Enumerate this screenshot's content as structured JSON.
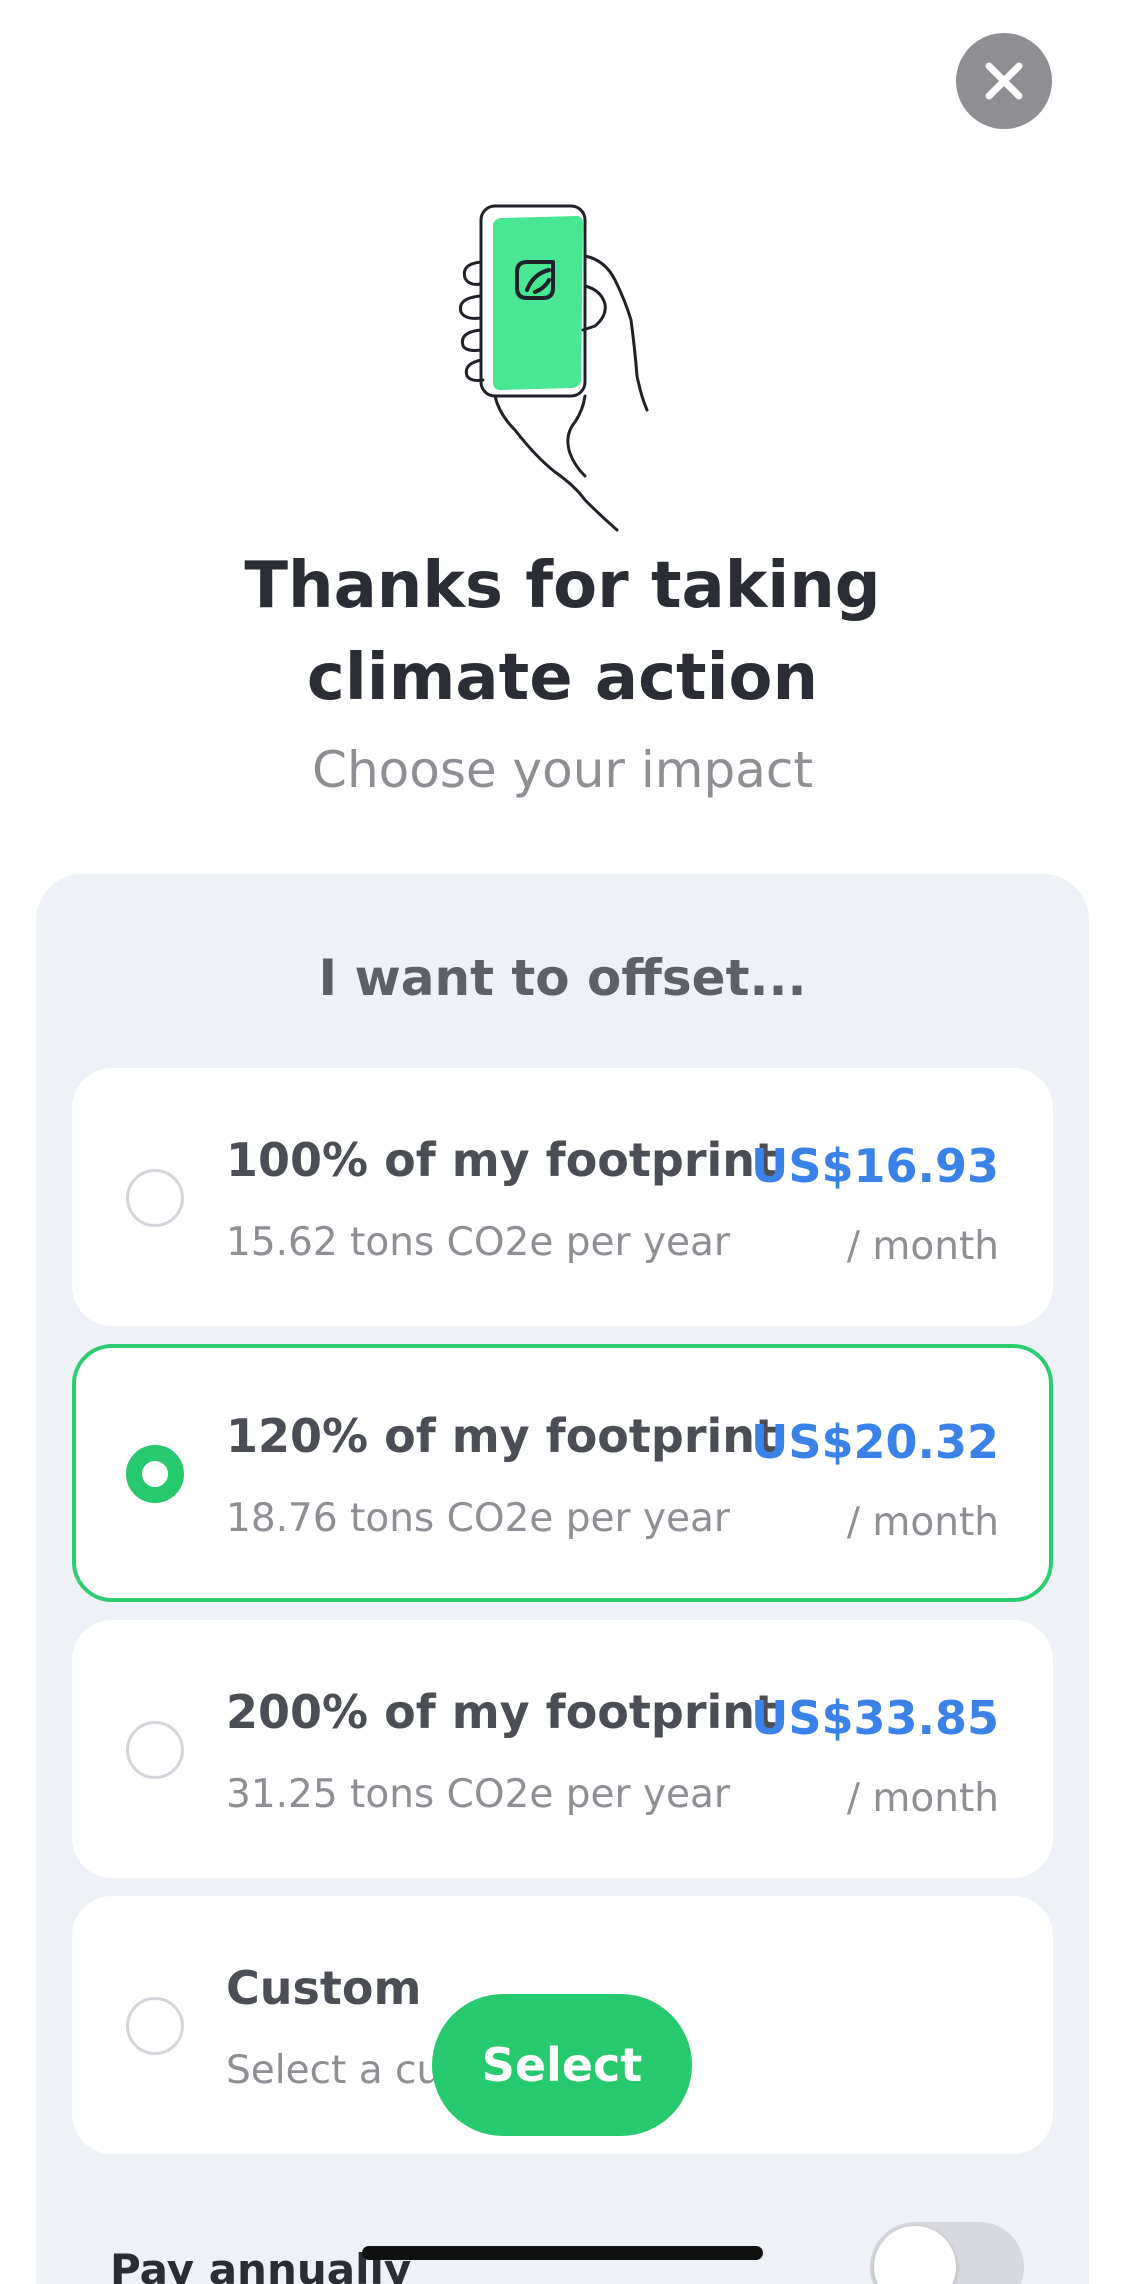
{
  "header": {
    "title_line1": "Thanks for taking",
    "title_line2": "climate action",
    "subtitle": "Choose your impact"
  },
  "offset": {
    "heading": "I want to offset...",
    "options": [
      {
        "label": "100% of my footprint",
        "sub": "15.62 tons CO2e per year",
        "price": "US$16.93",
        "period": "/ month",
        "selected": false
      },
      {
        "label": "120% of my footprint",
        "sub": "18.76 tons CO2e per year",
        "price": "US$20.32",
        "period": "/ month",
        "selected": true
      },
      {
        "label": "200% of my footprint",
        "sub": "31.25 tons CO2e per year",
        "price": "US$33.85",
        "period": "/ month",
        "selected": false
      },
      {
        "label": "Custom",
        "sub": "Select a cus",
        "selected": false
      }
    ]
  },
  "actions": {
    "select_label": "Select"
  },
  "billing": {
    "pay_annually_label": "Pay annually",
    "pay_annually_on": false
  },
  "colors": {
    "accent_green": "#27c96e",
    "price_blue": "#3b82e8",
    "panel_bg": "#eef1f6"
  },
  "icons": {
    "close": "close-icon",
    "illustration": "hand-phone-leaf-illustration"
  }
}
